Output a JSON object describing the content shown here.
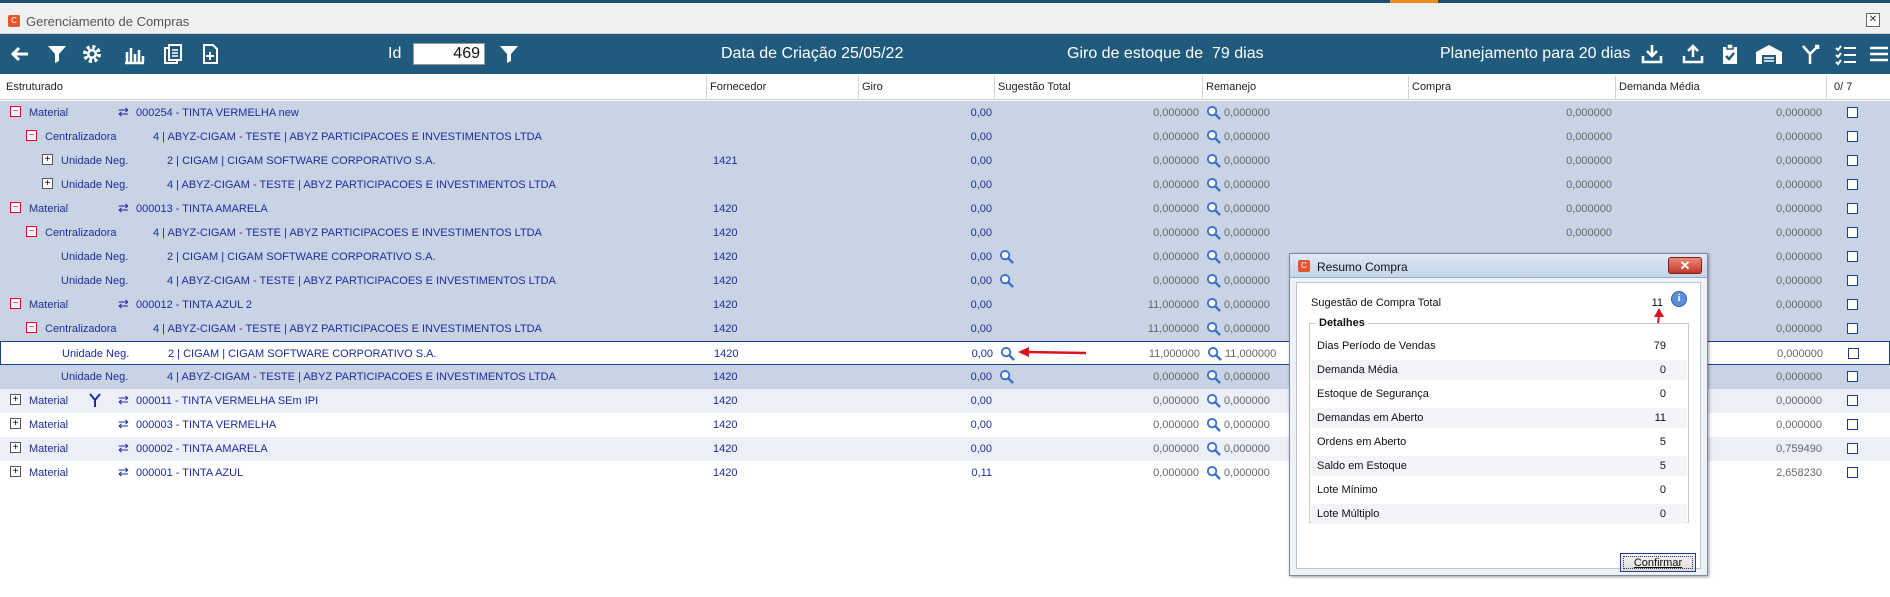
{
  "window": {
    "title": "Gerenciamento de Compras",
    "app_icon": "cigam-app-icon"
  },
  "toolbar": {
    "id_label": "Id",
    "id_value": "469",
    "data_criacao": "Data de Criação 25/05/22",
    "giro_label": "Giro de estoque de",
    "giro_value": "79 dias",
    "planejamento": "Planejamento para 20 dias",
    "icons": [
      "back-arrow-icon",
      "filter-icon",
      "gear-icon",
      "bar-chart-icon",
      "documents-icon",
      "new-document-icon",
      "filter-icon",
      "download-icon",
      "upload-icon",
      "clipboard-check-icon",
      "warehouse-icon",
      "branch-icon",
      "checklist-icon",
      "menu-icon"
    ]
  },
  "columns": {
    "estruturado": "Estruturado",
    "fornecedor": "Fornecedor",
    "giro": "Giro",
    "sugestao": "Sugestão Total",
    "remanejo": "Remanejo",
    "compra": "Compra",
    "demanda": "Demanda Média",
    "counter": "0/ 7"
  },
  "rows": [
    {
      "t0": "Material",
      "t1": "000254 - TINTA VERMELHA new",
      "forn": "",
      "giro": "0,00",
      "sug": "0,000000",
      "rem": "0,000000",
      "compra": "0,000000",
      "dem": "0,000000"
    },
    {
      "t0": "Centralizadora",
      "t1": "4   | ABYZ-CIGAM - TESTE | ABYZ PARTICIPACOES E INVESTIMENTOS LTDA",
      "forn": "",
      "giro": "0,00",
      "sug": "0,000000",
      "rem": "0,000000",
      "compra": "0,000000",
      "dem": "0,000000"
    },
    {
      "t0": "Unidade Neg.",
      "t1": "2 | CIGAM | CIGAM SOFTWARE CORPORATIVO S.A.",
      "forn": "1421",
      "giro": "0,00",
      "sug": "0,000000",
      "rem": "0,000000",
      "compra": "0,000000",
      "dem": "0,000000"
    },
    {
      "t0": "Unidade Neg.",
      "t1": "4 | ABYZ-CIGAM - TESTE | ABYZ PARTICIPACOES E INVESTIMENTOS LTDA",
      "forn": "",
      "giro": "0,00",
      "sug": "0,000000",
      "rem": "0,000000",
      "compra": "0,000000",
      "dem": "0,000000"
    },
    {
      "t0": "Material",
      "t1": "000013 - TINTA AMARELA",
      "forn": "1420",
      "giro": "0,00",
      "sug": "0,000000",
      "rem": "0,000000",
      "compra": "0,000000",
      "dem": "0,000000"
    },
    {
      "t0": "Centralizadora",
      "t1": "4   | ABYZ-CIGAM - TESTE | ABYZ PARTICIPACOES E INVESTIMENTOS LTDA",
      "forn": "1420",
      "giro": "0,00",
      "sug": "0,000000",
      "rem": "0,000000",
      "compra": "0,000000",
      "dem": "0,000000"
    },
    {
      "t0": "Unidade Neg.",
      "t1": "2 | CIGAM | CIGAM SOFTWARE CORPORATIVO S.A.",
      "forn": "1420",
      "giro": "0,00",
      "sug": "0,000000",
      "rem": "0,000000",
      "compra": "",
      "dem": "0,000000"
    },
    {
      "t0": "Unidade Neg.",
      "t1": "4 | ABYZ-CIGAM - TESTE | ABYZ PARTICIPACOES E INVESTIMENTOS LTDA",
      "forn": "1420",
      "giro": "0,00",
      "sug": "0,000000",
      "rem": "0,000000",
      "compra": "",
      "dem": "0,000000"
    },
    {
      "t0": "Material",
      "t1": "000012 - TINTA AZUL 2",
      "forn": "1420",
      "giro": "0,00",
      "sug": "11,000000",
      "rem": "0,000000",
      "compra": "",
      "dem": "0,000000"
    },
    {
      "t0": "Centralizadora",
      "t1": "4   | ABYZ-CIGAM - TESTE | ABYZ PARTICIPACOES E INVESTIMENTOS LTDA",
      "forn": "1420",
      "giro": "0,00",
      "sug": "11,000000",
      "rem": "0,000000",
      "compra": "",
      "dem": "0,000000"
    },
    {
      "t0": "Unidade Neg.",
      "t1": "2 | CIGAM | CIGAM SOFTWARE CORPORATIVO S.A.",
      "forn": "1420",
      "giro": "0,00",
      "sug": "11,000000",
      "rem": "11,000000",
      "compra": "",
      "dem": "0,000000"
    },
    {
      "t0": "Unidade Neg.",
      "t1": "4 | ABYZ-CIGAM - TESTE | ABYZ PARTICIPACOES E INVESTIMENTOS LTDA",
      "forn": "1420",
      "giro": "0,00",
      "sug": "0,000000",
      "rem": "0,000000",
      "compra": "",
      "dem": "0,000000"
    },
    {
      "t0": "Material",
      "t1": "000011 - TINTA VERMELHA SEm IPI",
      "forn": "1420",
      "giro": "0,00",
      "sug": "0,000000",
      "rem": "0,000000",
      "compra": "",
      "dem": "0,000000"
    },
    {
      "t0": "Material",
      "t1": "000003 - TINTA VERMELHA",
      "forn": "1420",
      "giro": "0,00",
      "sug": "0,000000",
      "rem": "0,000000",
      "compra": "",
      "dem": "0,000000"
    },
    {
      "t0": "Material",
      "t1": "000002 - TINTA AMARELA",
      "forn": "1420",
      "giro": "0,00",
      "sug": "0,000000",
      "rem": "0,000000",
      "compra": "",
      "dem": "0,759490"
    },
    {
      "t0": "Material",
      "t1": "000001 - TINTA AZUL",
      "forn": "1420",
      "giro": "0,11",
      "sug": "0,000000",
      "rem": "0,000000",
      "compra": "",
      "dem": "2,658230"
    }
  ],
  "dialog": {
    "title": "Resumo Compra",
    "total_label": "Sugestão de Compra Total",
    "total_value": "11",
    "detalhes": "Detalhes",
    "items": [
      {
        "label": "Dias Período de Vendas",
        "value": "79"
      },
      {
        "label": "Demanda Média",
        "value": "0"
      },
      {
        "label": "Estoque de Segurança",
        "value": "0"
      },
      {
        "label": "Demandas em Aberto",
        "value": "11"
      },
      {
        "label": "Ordens em Aberto",
        "value": "5"
      },
      {
        "label": "Saldo em Estoque",
        "value": "5"
      },
      {
        "label": "Lote Mínimo",
        "value": "0"
      },
      {
        "label": "Lote Múltiplo",
        "value": "0"
      }
    ],
    "confirm": "Confirmar"
  },
  "colors": {
    "toolbar": "#205b7d",
    "row_blue": "#c8d4e3",
    "text_blue": "#1b2ca0",
    "arrow_red": "#d9141e"
  }
}
